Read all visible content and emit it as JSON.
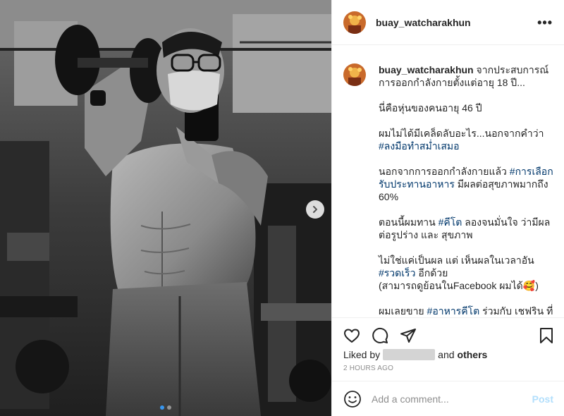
{
  "post": {
    "username": "buay_watcharakhun",
    "more_label": "•••",
    "caption": {
      "p1": "จากประสบการณ์การออกกำลังกายตั้งแต่อายุ 18 ปี...",
      "p2": "นี่คือหุ่นของคนอายุ 46 ปี",
      "p3_text": "ผมไม่ได้มีเคล็ดลับอะไร...นอกจากคำว่า",
      "p3_tag": "#ลงมือทำสม่ำเสมอ",
      "p4_pre": "นอกจากการออกกำลังกายแล้ว ",
      "p4_tag": "#การเลือกรับประทานอาหาร",
      "p4_post": " มีผลต่อสุขภาพมากถึง 60%",
      "p5_pre": "ตอนนี้ผมทาน ",
      "p5_tag": "#คีโต",
      "p5_post": " ลองจนมั่นใจ ว่ามีผลต่อรูปร่าง และ สุขภาพ",
      "p6_text": "ไม่ใช่แค่เป็นผล แต่ เห็นผลในเวลาอัน",
      "p6_tag": "#รวดเร็ว",
      "p6_post": " อีกด้วย",
      "p6_line2": "(สามารถดูย้อนในFacebook ผมได้🥰)",
      "p7_pre": "ผมเลยขาย ",
      "p7_tag": "#อาหารคีโต",
      "p7_post": " ร่วมกับ เชฟริน ที่"
    },
    "likes": {
      "prefix": "Liked by",
      "connector": "and",
      "others": "others"
    },
    "timestamp": "2 HOURS AGO",
    "comment": {
      "placeholder": "Add a comment...",
      "post_label": "Post"
    },
    "carousel": {
      "count": 2,
      "active_index": 0
    }
  },
  "colors": {
    "hashtag": "#00376b",
    "post_disabled": "#b2dffc",
    "active_dot": "#3897f0",
    "muted": "#8e8e8e"
  },
  "icons": [
    "more-icon",
    "next-arrow-icon",
    "heart-icon",
    "comment-icon",
    "share-icon",
    "bookmark-icon",
    "emoji-icon"
  ]
}
